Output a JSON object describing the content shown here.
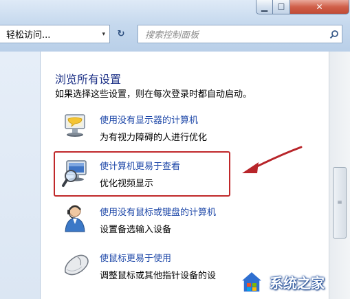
{
  "window": {
    "minimize_label": "▁",
    "maximize_label": "☐",
    "close_label": "✕"
  },
  "addressbar": {
    "path": "轻松访问...",
    "dropdown_glyph": "▾",
    "refresh_glyph": "↻"
  },
  "search": {
    "placeholder": "搜索控制面板",
    "icon": "search-icon"
  },
  "main": {
    "heading": "浏览所有设置",
    "subtitle": "如果选择这些设置，则在每次登录时都自动启动。",
    "items": [
      {
        "link": "使用没有显示器的计算机",
        "description": "为有视力障碍的人进行优化",
        "icon": "monitor-speech-icon"
      },
      {
        "link": "使计算机更易于查看",
        "description": "优化视频显示",
        "icon": "magnifier-monitor-icon"
      },
      {
        "link": "使用没有鼠标或键盘的计算机",
        "description": "设置备选输入设备",
        "icon": "headset-user-icon"
      },
      {
        "link": "使鼠标更易于使用",
        "description": "调整鼠标或其他指针设备的设",
        "icon": "mouse-icon"
      }
    ]
  },
  "annotation": {
    "color": "#c0282a"
  },
  "scrollbar": {
    "grip_glyph": "≡"
  },
  "watermark": {
    "text": "系统之家"
  }
}
